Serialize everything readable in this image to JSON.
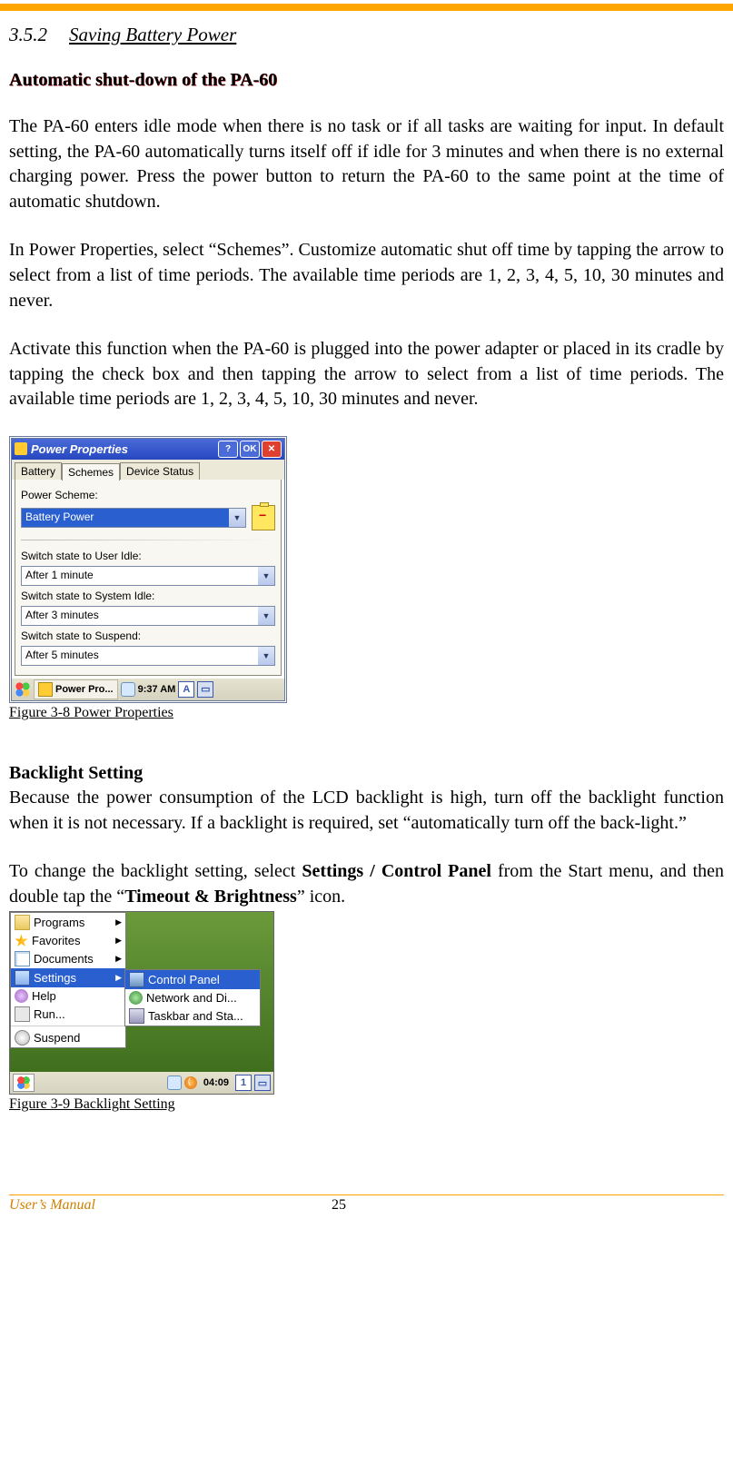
{
  "section": {
    "number": "3.5.2",
    "title": "Saving Battery Power"
  },
  "sub1": {
    "heading": "Automatic shut-down of the PA-60",
    "p1": "The PA-60 enters idle mode when there is no task or if all tasks are waiting for input. In default setting, the PA-60 automatically turns itself off if idle for 3 minutes and when there is no external charging power. Press the power button to return the PA-60 to the same point at the time of automatic shutdown.",
    "p2": "In Power Properties, select “Schemes”. Customize automatic shut off time by tapping the arrow to select from a list of time periods. The available time periods are 1, 2, 3, 4, 5, 10, 30 minutes and never.",
    "p3": "Activate this function when the PA-60 is plugged into the power adapter or placed in its cradle by tapping the check box and then tapping the arrow to select from a list of time periods. The available time periods are 1, 2, 3, 4, 5, 10, 30 minutes and never."
  },
  "scr1": {
    "title": "Power Properties",
    "help": "?",
    "ok": "OK",
    "close": "✕",
    "tabs": {
      "t1": "Battery",
      "t2": "Schemes",
      "t3": "Device Status"
    },
    "power_scheme_label": "Power Scheme:",
    "power_scheme_value": "Battery Power",
    "user_idle_label": "Switch state to User Idle:",
    "user_idle_value": "After 1 minute",
    "system_idle_label": "Switch state to System Idle:",
    "system_idle_value": "After 3 minutes",
    "suspend_label": "Switch state to Suspend:",
    "suspend_value": "After 5 minutes",
    "taskbar_app": "Power Pro...",
    "taskbar_time": "9:37 AM",
    "taskbar_A": "A"
  },
  "fig1_caption": "Figure 3-8 Power Properties",
  "sub2": {
    "heading": "Backlight Setting",
    "p1": "Because the power consumption of the LCD backlight is high, turn off the backlight function when it is not necessary. If a backlight is required, set “automatically turn off the back-light.”",
    "p2a": "To change the backlight setting, select ",
    "p2b": "Settings / Control Panel",
    "p2c": " from the Start menu, and then double tap the “",
    "p2d": "Timeout & Brightness",
    "p2e": "” icon."
  },
  "scr2": {
    "menu": {
      "programs": "Programs",
      "favorites": "Favorites",
      "documents": "Documents",
      "settings": "Settings",
      "help": "Help",
      "run": "Run...",
      "suspend": "Suspend"
    },
    "sub": {
      "cp": "Control Panel",
      "net": "Network and Di...",
      "tb": "Taskbar and Sta..."
    },
    "clock": "04:09",
    "one": "1"
  },
  "fig2_caption": "Figure 3-9 Backlight Setting",
  "footer": {
    "label": "User’s Manual",
    "page": "25"
  }
}
